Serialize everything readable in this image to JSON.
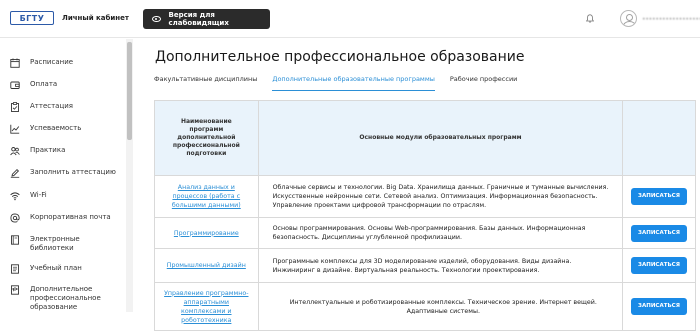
{
  "header": {
    "logo_text": "БГТУ",
    "cabinet_title": "Личный кабинет",
    "vision_button": "Версия для слабовидящих",
    "username": "••••••••••••••••••"
  },
  "sidebar": {
    "items": [
      {
        "label": "Расписание",
        "icon": "calendar-icon"
      },
      {
        "label": "Оплата",
        "icon": "wallet-icon"
      },
      {
        "label": "Аттестация",
        "icon": "clipboard-icon"
      },
      {
        "label": "Успеваемость",
        "icon": "chart-icon"
      },
      {
        "label": "Практика",
        "icon": "people-icon"
      },
      {
        "label": "Заполнить аттестацию",
        "icon": "edit-icon"
      },
      {
        "label": "Wi-Fi",
        "icon": "wifi-icon"
      },
      {
        "label": "Корпоративная почта",
        "icon": "at-icon"
      },
      {
        "label": "Электронные библиотеки",
        "icon": "book-icon"
      },
      {
        "label": "Учебный план",
        "icon": "document-icon"
      },
      {
        "label": "Дополнительное профессиональное образование",
        "icon": "graduation-icon"
      }
    ]
  },
  "main": {
    "title": "Дополнительное профессиональное образование",
    "tabs": [
      {
        "label": "Факультативные дисциплины",
        "active": false
      },
      {
        "label": "Дополнительные образовательные программы",
        "active": true
      },
      {
        "label": "Рабочие профессии",
        "active": false
      }
    ],
    "table": {
      "headers": [
        "Наименование программ дополнительной профессиональной подготовки",
        "Основные модули образовательных программ",
        ""
      ],
      "rows": [
        {
          "program": "Анализ данных и процессов (работа с большими данными)",
          "modules": "Облачные сервисы и технологии. Big Data. Хранилища данных. Граничные и туманные вычисления. Искусственные нейронные сети. Сетевой анализ. Оптимизация. Информационная безопасность. Управление проектами цифровой трансформации по отраслям.",
          "action": "ЗАПИСАТЬСЯ"
        },
        {
          "program": "Программирование",
          "modules": "Основы программирования. Основы Web-программирования. Базы данных. Информационная безопасность. Дисциплины углубленной профилизации.",
          "action": "ЗАПИСАТЬСЯ"
        },
        {
          "program": "Промышленный дизайн",
          "modules": "Программные комплексы для 3D моделирование изделий, оборудования. Виды дизайна. Инжиниринг в дизайне. Виртуальная реальность. Технологии проектирования.",
          "action": "ЗАПИСАТЬСЯ"
        },
        {
          "program": "Управление программно-аппаратными комплексами и робототехника",
          "modules": "Интеллектуальные и роботизированные комплексы. Техническое зрение. Интернет вещей. Адаптивные системы.",
          "action": "ЗАПИСАТЬСЯ"
        }
      ]
    }
  },
  "colors": {
    "accent": "#2b8fd6",
    "button": "#1a8ae6",
    "header_bg": "#e9f3fb",
    "dark_button": "#2b2b2b"
  }
}
